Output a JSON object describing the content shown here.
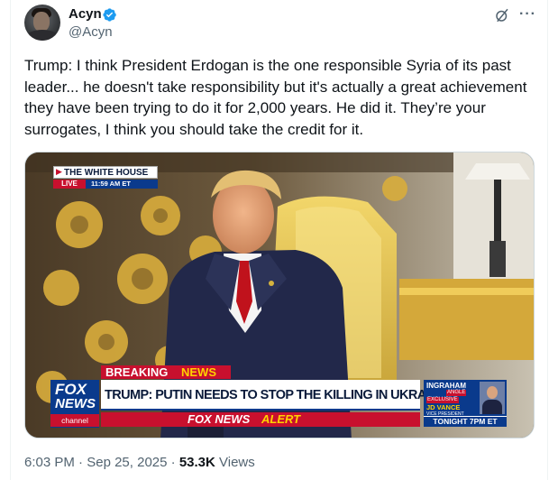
{
  "author": {
    "display_name": "Acyn",
    "handle": "@Acyn",
    "verified": true,
    "verified_color": "#1d9bf0"
  },
  "tweet": {
    "text": "Trump: I think President Erdogan is the one responsible Syria of its past leader... he doesn't take responsibility but it's actually a great achievement they have been trying to do it for 2,000 years. He did it. They’re your surrogates, I think you should take the credit for it."
  },
  "media": {
    "location_bug": "THE WHITE HOUSE",
    "live_label": "LIVE",
    "live_time": "11:59 AM ET",
    "breaking_label_a": "BREAKING",
    "breaking_label_b": "NEWS",
    "headline": "TRUMP: PUTIN NEEDS TO STOP THE KILLING IN UKRAINE",
    "alert_label_a": "FOX NEWS",
    "alert_label_b": "ALERT",
    "logo_top": "FOX",
    "logo_bottom": "NEWS",
    "logo_channel": "channel",
    "promo_show_a": "INGRAHAM",
    "promo_show_b": "ANGLE",
    "promo_exclusive": "EXCLUSIVE",
    "promo_guest": "JD VANCE",
    "promo_guest_title": "VICE PRESIDENT",
    "promo_time": "TONIGHT 7PM ET",
    "colors": {
      "fox_red": "#c8102e",
      "fox_blue": "#0a3a8c",
      "alert_yellow": "#ffd200"
    }
  },
  "meta": {
    "time": "6:03 PM",
    "separator": "·",
    "date": "Sep 25, 2025",
    "views_count": "53.3K",
    "views_label": "Views"
  },
  "icons": {
    "verified": "verified-badge-icon",
    "grok": "grok-icon",
    "more": "more-icon"
  }
}
